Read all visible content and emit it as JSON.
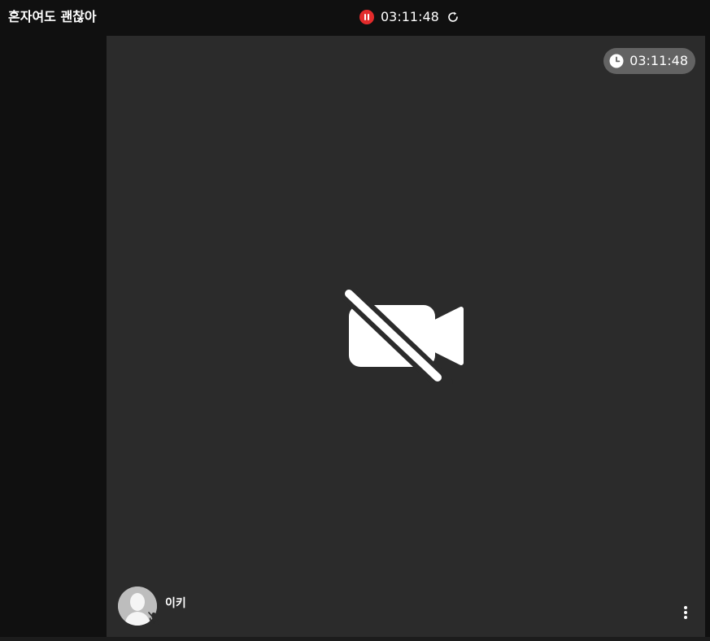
{
  "header": {
    "room_title": "혼자여도 괜찮아",
    "recording": {
      "status_icon": "pause-circle-icon",
      "time": "03:11:48",
      "refresh_icon": "refresh-icon"
    }
  },
  "stage": {
    "timer": {
      "icon": "clock-icon",
      "time": "03:11:48"
    },
    "video_state_icon": "video-off-icon",
    "participant": {
      "name": "이키",
      "avatar_icon": "user-silhouette-icon",
      "mic_icon": "mic-off-icon"
    },
    "menu_icon": "more-vertical-icon"
  },
  "colors": {
    "background": "#101010",
    "stage": "#2b2b2b",
    "record_red": "#e32b2b",
    "timer_pill": "#636363",
    "avatar": "#bdbdbd"
  }
}
